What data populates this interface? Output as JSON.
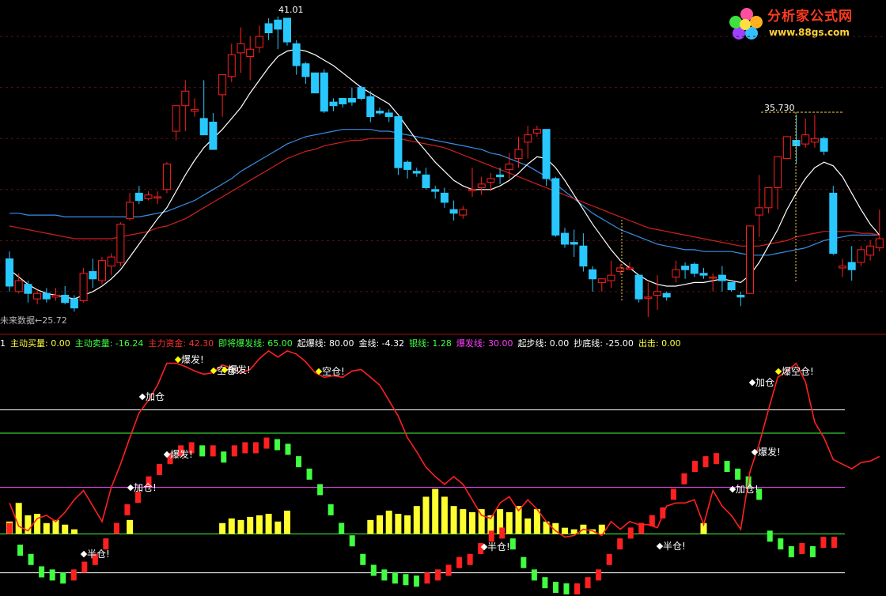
{
  "watermark": {
    "title": "分析家公式网",
    "url": "www.88gs.com"
  },
  "main_panel": {
    "high_label": "41.01",
    "recent_high_label": "35.730",
    "low_label": "未来数据←25.72"
  },
  "indicator_bar": [
    {
      "text": "1",
      "color": "#ffffff"
    },
    {
      "text": "主动买量: 0.00",
      "color": "#ffff40"
    },
    {
      "text": "主动卖量: -16.24",
      "color": "#40ff40"
    },
    {
      "text": "主力资金: 42.30",
      "color": "#ff3030"
    },
    {
      "text": "即将爆发线: 65.00",
      "color": "#40ff40"
    },
    {
      "text": "起爆线: 80.00",
      "color": "#ffffff"
    },
    {
      "text": "金线: -4.32",
      "color": "#ffffff"
    },
    {
      "text": "银线: 1.28",
      "color": "#40ff40"
    },
    {
      "text": "爆发线: 30.00",
      "color": "#ff40ff"
    },
    {
      "text": "起步线: 0.00",
      "color": "#ffffff"
    },
    {
      "text": "抄底线: -25.00",
      "color": "#ffffff"
    },
    {
      "text": "出击: 0.00",
      "color": "#ffff40"
    }
  ],
  "signals": [
    {
      "text": "加仓",
      "color": "#ffffff",
      "dot": "#ffffff"
    },
    {
      "text": "爆发!",
      "color": "#ffffff",
      "dot": "#ffff00"
    },
    {
      "text": "空仓!",
      "color": "#ffffff",
      "dot": "#ffff00"
    },
    {
      "text": "爆发!",
      "color": "#ffffff",
      "dot": "#ffff00"
    },
    {
      "text": "空仓!",
      "color": "#ffffff",
      "dot": "#ffff00"
    },
    {
      "text": "爆发!",
      "color": "#ffffff",
      "dot": "#ffffff"
    },
    {
      "text": "加仓!",
      "color": "#ffffff",
      "dot": "#ffffff"
    },
    {
      "text": "半仓!",
      "color": "#ffffff",
      "dot": "#ffffff"
    },
    {
      "text": "半仓!",
      "color": "#ffffff",
      "dot": "#ffffff"
    },
    {
      "text": "半仓!",
      "color": "#ffffff",
      "dot": "#ffffff"
    },
    {
      "text": "加仓",
      "color": "#ffffff",
      "dot": "#ffffff"
    },
    {
      "text": "爆空仓!",
      "color": "#ffffff",
      "dot": "#ffff00"
    },
    {
      "text": "爆发!",
      "color": "#ffffff",
      "dot": "#ffffff"
    },
    {
      "text": "加仓!",
      "color": "#ffffff",
      "dot": "#ffffff"
    }
  ],
  "colors": {
    "up": "#ff2020",
    "down": "#28c8ff",
    "ma_short": "#ffffff",
    "ma_mid": "#d02020",
    "ma_long": "#3a8ee6"
  },
  "chart_data": [
    {
      "type": "candlestick",
      "ylim": [
        24,
        42
      ],
      "ohlc": [
        [
          27.8,
          28.2,
          26.0,
          26.3
        ],
        [
          26.0,
          27.0,
          25.9,
          26.6
        ],
        [
          26.4,
          26.6,
          25.4,
          25.9
        ],
        [
          25.6,
          26.1,
          25.3,
          25.9
        ],
        [
          25.9,
          26.2,
          25.4,
          25.6
        ],
        [
          25.7,
          26.2,
          25.5,
          25.8
        ],
        [
          25.8,
          26.3,
          25.3,
          25.4
        ],
        [
          25.6,
          25.8,
          24.9,
          25.1
        ],
        [
          25.5,
          27.3,
          25.4,
          27.0
        ],
        [
          27.1,
          27.8,
          26.2,
          26.7
        ],
        [
          26.6,
          27.9,
          26.4,
          27.7
        ],
        [
          27.4,
          28.1,
          26.9,
          27.9
        ],
        [
          27.6,
          29.8,
          27.4,
          29.7
        ],
        [
          30.0,
          31.4,
          29.9,
          30.9
        ],
        [
          31.4,
          31.8,
          30.8,
          31.0
        ],
        [
          31.1,
          31.5,
          31.0,
          31.3
        ],
        [
          31.2,
          31.5,
          30.8,
          31.2
        ],
        [
          31.6,
          33.1,
          31.4,
          33.0
        ],
        [
          34.8,
          35.8,
          34.3,
          36.2
        ],
        [
          36.2,
          37.6,
          34.8,
          37.0
        ],
        [
          35.9,
          36.6,
          35.6,
          36.0
        ],
        [
          35.5,
          37.6,
          34.6,
          34.6
        ],
        [
          35.3,
          35.8,
          33.8,
          33.8
        ],
        [
          36.8,
          37.6,
          35.6,
          37.9
        ],
        [
          37.8,
          39.6,
          37.5,
          39.0
        ],
        [
          39.1,
          40.5,
          38.0,
          39.6
        ],
        [
          38.9,
          40.0,
          37.6,
          39.3
        ],
        [
          39.4,
          40.6,
          39.1,
          40.0
        ],
        [
          40.7,
          41.0,
          39.8,
          40.2
        ],
        [
          40.9,
          41.1,
          39.3,
          40.4
        ],
        [
          41.0,
          41.0,
          39.5,
          39.7
        ],
        [
          39.6,
          39.8,
          37.9,
          38.4
        ],
        [
          38.5,
          38.6,
          37.4,
          37.8
        ],
        [
          38.0,
          38.0,
          36.9,
          36.9
        ],
        [
          38.0,
          38.2,
          35.8,
          35.9
        ],
        [
          36.4,
          36.6,
          35.9,
          36.2
        ],
        [
          36.6,
          36.6,
          36.1,
          36.3
        ],
        [
          36.6,
          37.2,
          36.2,
          36.4
        ],
        [
          37.2,
          37.3,
          36.5,
          36.6
        ],
        [
          36.7,
          37.0,
          35.3,
          35.6
        ],
        [
          35.9,
          36.1,
          35.7,
          35.8
        ],
        [
          35.8,
          36.0,
          35.3,
          35.6
        ],
        [
          35.6,
          35.6,
          32.4,
          32.8
        ],
        [
          33.1,
          33.2,
          32.2,
          32.7
        ],
        [
          32.6,
          32.8,
          32.3,
          32.5
        ],
        [
          32.4,
          32.8,
          31.6,
          31.7
        ],
        [
          31.6,
          31.8,
          31.1,
          31.5
        ],
        [
          31.4,
          31.7,
          30.6,
          30.9
        ],
        [
          30.5,
          31.0,
          29.9,
          30.3
        ],
        [
          30.2,
          30.7,
          30.0,
          30.5
        ],
        [
          31.6,
          32.8,
          31.2,
          31.6
        ],
        [
          31.7,
          32.3,
          31.3,
          31.9
        ],
        [
          32.0,
          32.5,
          31.5,
          32.2
        ],
        [
          32.4,
          32.8,
          31.9,
          32.3
        ],
        [
          32.7,
          33.6,
          32.2,
          33.0
        ],
        [
          33.3,
          34.5,
          32.8,
          33.8
        ],
        [
          34.2,
          35.1,
          33.3,
          34.6
        ],
        [
          34.7,
          35.1,
          34.5,
          34.9
        ],
        [
          34.9,
          34.9,
          31.8,
          32.2
        ],
        [
          32.2,
          32.3,
          29.0,
          29.1
        ],
        [
          29.2,
          29.5,
          28.4,
          28.6
        ],
        [
          28.7,
          29.4,
          27.9,
          28.6
        ],
        [
          28.5,
          29.2,
          27.1,
          27.4
        ],
        [
          27.2,
          27.4,
          26.0,
          26.7
        ],
        [
          26.5,
          26.7,
          26.0,
          26.7
        ],
        [
          26.6,
          27.7,
          26.2,
          26.9
        ],
        [
          27.1,
          27.5,
          26.9,
          27.3
        ],
        [
          27.3,
          27.6,
          27.2,
          27.3
        ],
        [
          26.9,
          26.9,
          25.4,
          25.6
        ],
        [
          25.7,
          26.5,
          24.6,
          25.7
        ],
        [
          25.8,
          26.9,
          25.0,
          26.0
        ],
        [
          25.9,
          26.0,
          25.5,
          25.7
        ],
        [
          26.8,
          27.7,
          26.5,
          27.2
        ],
        [
          27.4,
          27.6,
          26.7,
          27.2
        ],
        [
          27.5,
          27.6,
          26.8,
          27.0
        ],
        [
          27.0,
          27.3,
          26.7,
          26.9
        ],
        [
          26.8,
          27.0,
          26.0,
          26.8
        ],
        [
          26.9,
          27.4,
          26.0,
          26.6
        ],
        [
          26.5,
          26.5,
          26.0,
          26.1
        ],
        [
          25.8,
          26.0,
          25.2,
          25.7
        ],
        [
          25.9,
          29.6,
          25.9,
          29.6
        ],
        [
          30.2,
          32.4,
          29.0,
          30.6
        ],
        [
          30.6,
          31.5,
          30.3,
          31.7
        ],
        [
          31.7,
          33.3,
          30.5,
          33.4
        ],
        [
          33.3,
          34.5,
          33.8,
          34.5
        ],
        [
          34.3,
          35.7,
          33.0,
          34.0
        ],
        [
          34.1,
          35.5,
          33.9,
          34.6
        ],
        [
          34.2,
          35.7,
          33.9,
          34.4
        ],
        [
          34.4,
          34.5,
          33.5,
          33.7
        ],
        [
          31.4,
          31.8,
          28.0,
          28.1
        ],
        [
          27.3,
          27.8,
          26.8,
          27.4
        ],
        [
          27.6,
          28.5,
          26.6,
          27.2
        ],
        [
          27.6,
          28.5,
          27.4,
          28.3
        ],
        [
          28.0,
          28.8,
          27.7,
          28.5
        ],
        [
          28.4,
          30.5,
          28.2,
          28.9
        ]
      ],
      "ma_short": [
        27.2,
        26.8,
        26.4,
        26.1,
        25.9,
        25.8,
        25.7,
        25.6,
        25.8,
        26.0,
        26.3,
        26.7,
        27.2,
        27.9,
        28.6,
        29.3,
        30.0,
        30.6,
        31.5,
        32.4,
        33.2,
        33.9,
        34.4,
        34.9,
        35.5,
        36.1,
        36.9,
        37.6,
        38.3,
        38.9,
        39.2,
        39.3,
        39.2,
        39.0,
        38.7,
        38.4,
        38.0,
        37.6,
        37.2,
        36.9,
        36.6,
        36.3,
        35.7,
        35.0,
        34.3,
        33.7,
        33.1,
        32.6,
        32.1,
        31.8,
        31.6,
        31.6,
        31.6,
        31.8,
        32.1,
        32.5,
        33.0,
        33.4,
        33.3,
        32.8,
        32.1,
        31.3,
        30.5,
        29.7,
        29.0,
        28.3,
        27.7,
        27.3,
        26.9,
        26.6,
        26.4,
        26.3,
        26.3,
        26.4,
        26.5,
        26.5,
        26.6,
        26.7,
        26.6,
        26.5,
        26.9,
        27.6,
        28.5,
        29.4,
        30.5,
        31.4,
        32.2,
        32.8,
        33.1,
        32.9,
        32.3,
        31.4,
        30.5,
        29.7,
        29.1
      ],
      "ma_mid": [
        29.6,
        29.5,
        29.4,
        29.3,
        29.2,
        29.1,
        29.0,
        28.9,
        28.9,
        28.9,
        28.9,
        28.9,
        29.0,
        29.1,
        29.2,
        29.3,
        29.5,
        29.6,
        29.8,
        30.0,
        30.3,
        30.6,
        30.9,
        31.2,
        31.5,
        31.8,
        32.1,
        32.4,
        32.7,
        33.0,
        33.3,
        33.5,
        33.7,
        33.8,
        34.0,
        34.1,
        34.2,
        34.3,
        34.3,
        34.4,
        34.4,
        34.4,
        34.4,
        34.3,
        34.2,
        34.1,
        34.0,
        33.9,
        33.7,
        33.5,
        33.3,
        33.1,
        32.9,
        32.7,
        32.5,
        32.3,
        32.1,
        31.9,
        31.7,
        31.5,
        31.3,
        31.1,
        30.9,
        30.7,
        30.5,
        30.3,
        30.1,
        29.9,
        29.7,
        29.5,
        29.4,
        29.3,
        29.2,
        29.1,
        29.0,
        28.9,
        28.8,
        28.7,
        28.6,
        28.5,
        28.5,
        28.5,
        28.6,
        28.7,
        28.8,
        29.0,
        29.1,
        29.2,
        29.3,
        29.3,
        29.3,
        29.3,
        29.2,
        29.2,
        29.1
      ],
      "ma_long": [
        30.3,
        30.3,
        30.2,
        30.2,
        30.2,
        30.2,
        30.1,
        30.1,
        30.1,
        30.1,
        30.1,
        30.1,
        30.1,
        30.1,
        30.1,
        30.2,
        30.3,
        30.4,
        30.6,
        30.8,
        31.0,
        31.3,
        31.6,
        31.9,
        32.2,
        32.6,
        32.9,
        33.2,
        33.5,
        33.8,
        34.1,
        34.3,
        34.5,
        34.6,
        34.7,
        34.8,
        34.9,
        34.9,
        34.9,
        34.9,
        34.8,
        34.8,
        34.7,
        34.6,
        34.5,
        34.4,
        34.3,
        34.2,
        34.1,
        34.0,
        33.9,
        33.8,
        33.6,
        33.5,
        33.3,
        33.1,
        32.9,
        32.6,
        32.3,
        31.9,
        31.5,
        31.1,
        30.7,
        30.3,
        30.0,
        29.7,
        29.4,
        29.2,
        29.0,
        28.8,
        28.6,
        28.5,
        28.4,
        28.3,
        28.3,
        28.2,
        28.2,
        28.2,
        28.2,
        28.1,
        28.0,
        28.0,
        28.0,
        28.1,
        28.2,
        28.3,
        28.4,
        28.6,
        28.8,
        28.9,
        29.0,
        29.1,
        29.1,
        29.1,
        29.1
      ]
    },
    {
      "type": "indicator",
      "ylim": [
        -40,
        120
      ],
      "hlines": [
        {
          "y": 80,
          "color": "#ffffff"
        },
        {
          "y": 65,
          "color": "#40ff40"
        },
        {
          "y": 30,
          "color": "#ff40ff"
        },
        {
          "y": 0,
          "color": "#40ff40"
        },
        {
          "y": -25,
          "color": "#ffffff"
        }
      ],
      "main_force": [
        20,
        5,
        2,
        10,
        12,
        8,
        14,
        22,
        28,
        18,
        8,
        30,
        45,
        62,
        78,
        86,
        96,
        110,
        110,
        108,
        105,
        103,
        104,
        109,
        107,
        104,
        106,
        113,
        118,
        114,
        118,
        116,
        111,
        104,
        101,
        102,
        101,
        105,
        106,
        101,
        96,
        86,
        76,
        62,
        53,
        43,
        37,
        32,
        37,
        32,
        22,
        12,
        10,
        20,
        24,
        15,
        22,
        16,
        8,
        2,
        -2,
        -1,
        3,
        2,
        -1,
        8,
        3,
        8,
        6,
        6,
        4,
        18,
        20,
        20,
        22,
        6,
        28,
        18,
        12,
        3,
        40,
        58,
        80,
        101,
        105,
        110,
        98,
        72,
        62,
        48,
        45,
        42,
        46,
        47,
        50
      ],
      "active_buy": [
        8,
        20,
        12,
        13,
        7,
        9,
        6,
        3,
        0,
        0,
        0,
        0,
        0,
        9,
        0,
        0,
        0,
        0,
        0,
        0,
        0,
        0,
        0,
        7,
        10,
        9,
        11,
        12,
        13,
        8,
        15,
        0,
        0,
        0,
        0,
        0,
        0,
        0,
        0,
        9,
        12,
        15,
        13,
        12,
        18,
        24,
        29,
        24,
        18,
        16,
        14,
        16,
        12,
        16,
        14,
        18,
        10,
        16,
        8,
        7,
        4,
        3,
        6,
        3,
        6,
        0,
        0,
        0,
        0,
        0,
        0,
        0,
        0,
        0,
        0,
        7,
        0,
        0,
        0,
        0,
        0,
        0,
        0,
        0,
        0,
        0,
        0,
        0,
        0,
        0,
        0,
        0,
        0,
        0,
        0
      ],
      "steps": [
        0,
        -14,
        -20,
        -28,
        -30,
        -32,
        -30,
        -25,
        -20,
        -10,
        0,
        12,
        20,
        30,
        38,
        45,
        50,
        52,
        50,
        50,
        46,
        50,
        52,
        52,
        55,
        54,
        51,
        43,
        35,
        25,
        12,
        0,
        -8,
        -20,
        -27,
        -30,
        -32,
        -33,
        -34,
        -32,
        -30,
        -27,
        -22,
        -20,
        -13,
        -5,
        -3,
        -10,
        -22,
        -30,
        -35,
        -38,
        -39,
        -39,
        -35,
        -30,
        -20,
        -10,
        -3,
        0,
        5,
        10,
        22,
        32,
        40,
        43,
        45,
        40,
        35,
        30,
        22,
        -5,
        -10,
        -15,
        -13,
        -15,
        -9,
        -9
      ],
      "gold": [
        -4.3,
        1.3
      ]
    }
  ]
}
